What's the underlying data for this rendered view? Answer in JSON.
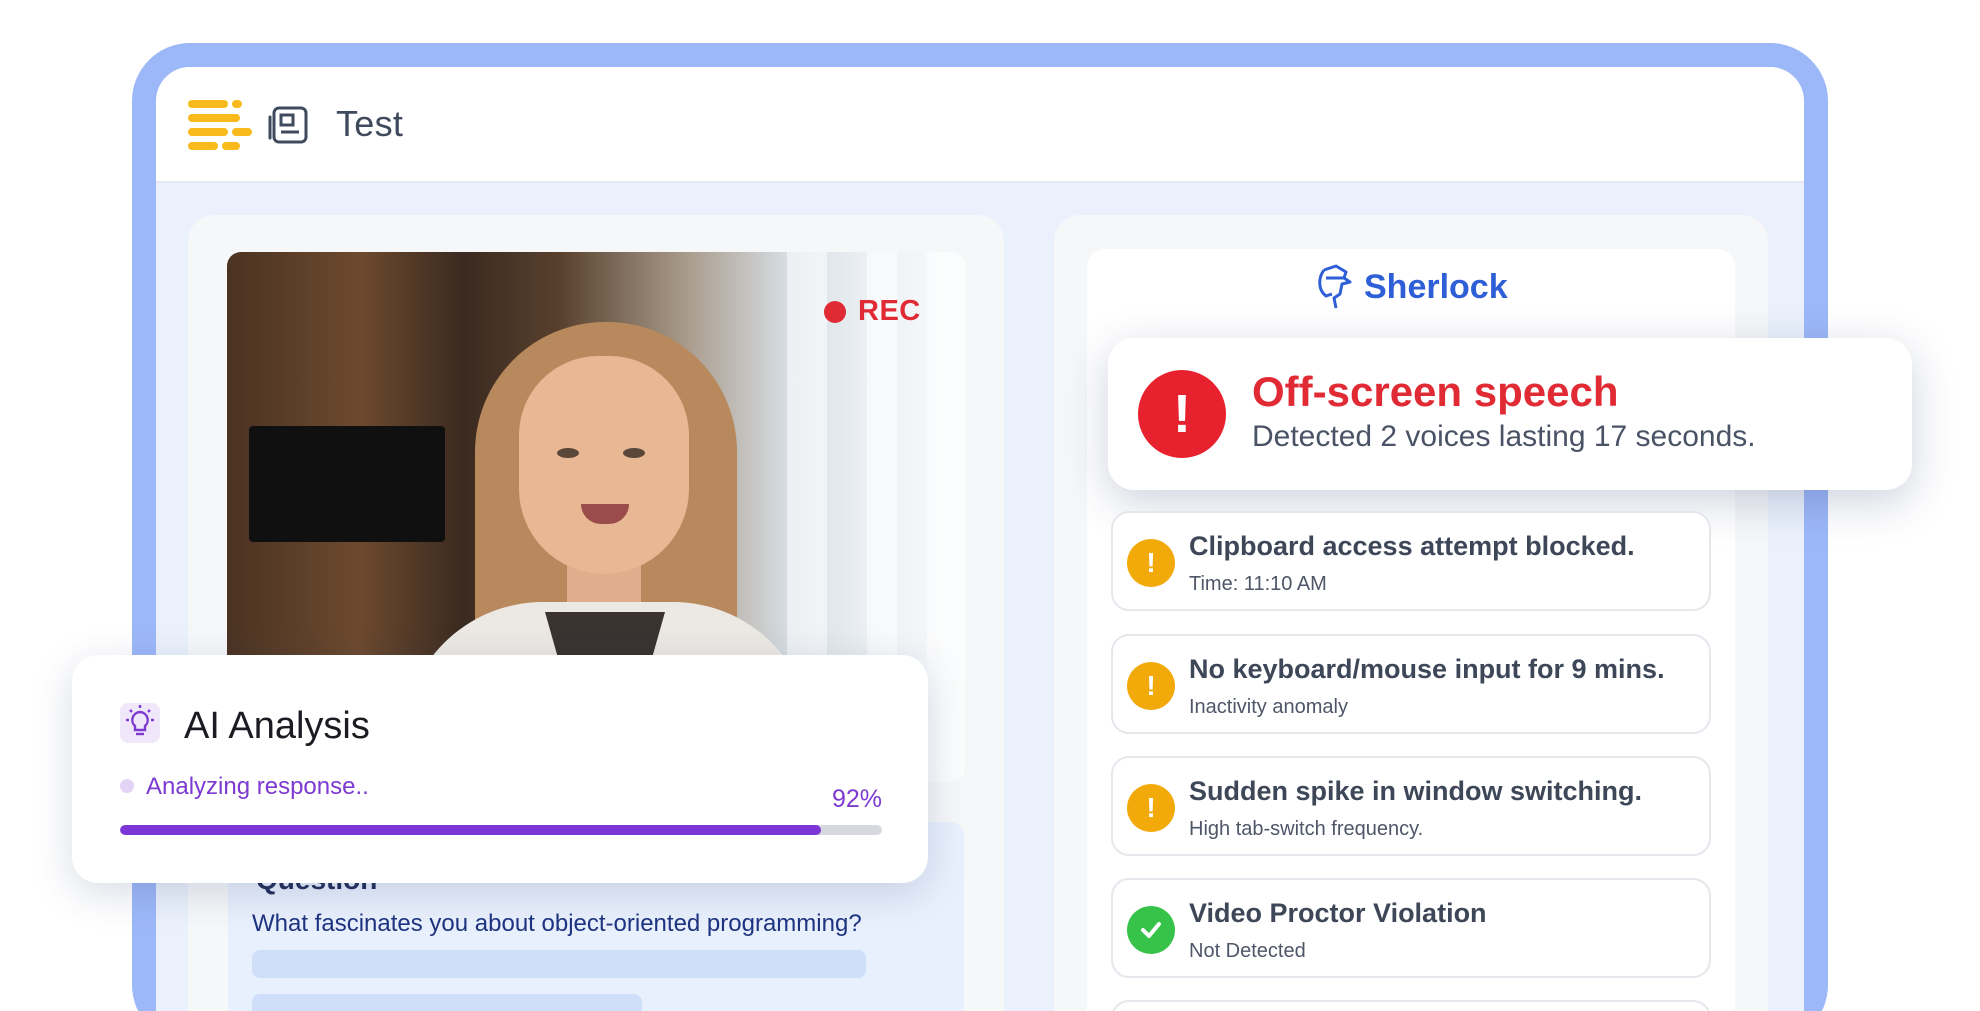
{
  "header": {
    "title": "Test"
  },
  "video": {
    "rec_label": "REC"
  },
  "ai_analysis": {
    "title": "AI Analysis",
    "status": "Analyzing response..",
    "progress_label": "92%",
    "progress": 0.92
  },
  "question": {
    "heading": "Question",
    "text": "What fascinates you about object-oriented programming?"
  },
  "sherlock": {
    "brand": "Sherlock",
    "alert": {
      "title": "Off-screen speech",
      "subtitle": "Detected 2 voices lasting 17 seconds."
    },
    "events": [
      {
        "title": "Clipboard access attempt blocked.",
        "subtitle": "Time: 11:10 AM",
        "status": "warning",
        "icon": "exclamation-icon"
      },
      {
        "title": "No keyboard/mouse input for 9 mins.",
        "subtitle": "Inactivity anomaly",
        "status": "warning",
        "icon": "exclamation-icon"
      },
      {
        "title": "Sudden spike in window switching.",
        "subtitle": "High tab-switch frequency.",
        "status": "warning",
        "icon": "exclamation-icon"
      },
      {
        "title": "Video Proctor Violation",
        "subtitle": "Not Detected",
        "status": "ok",
        "icon": "check-icon"
      }
    ]
  },
  "colors": {
    "frame": "#9db8f8",
    "alert_red": "#e02a34",
    "warning": "#f2aa0b",
    "success": "#37c24a",
    "purple": "#7c36d6",
    "brand_blue": "#2e5fd7"
  }
}
